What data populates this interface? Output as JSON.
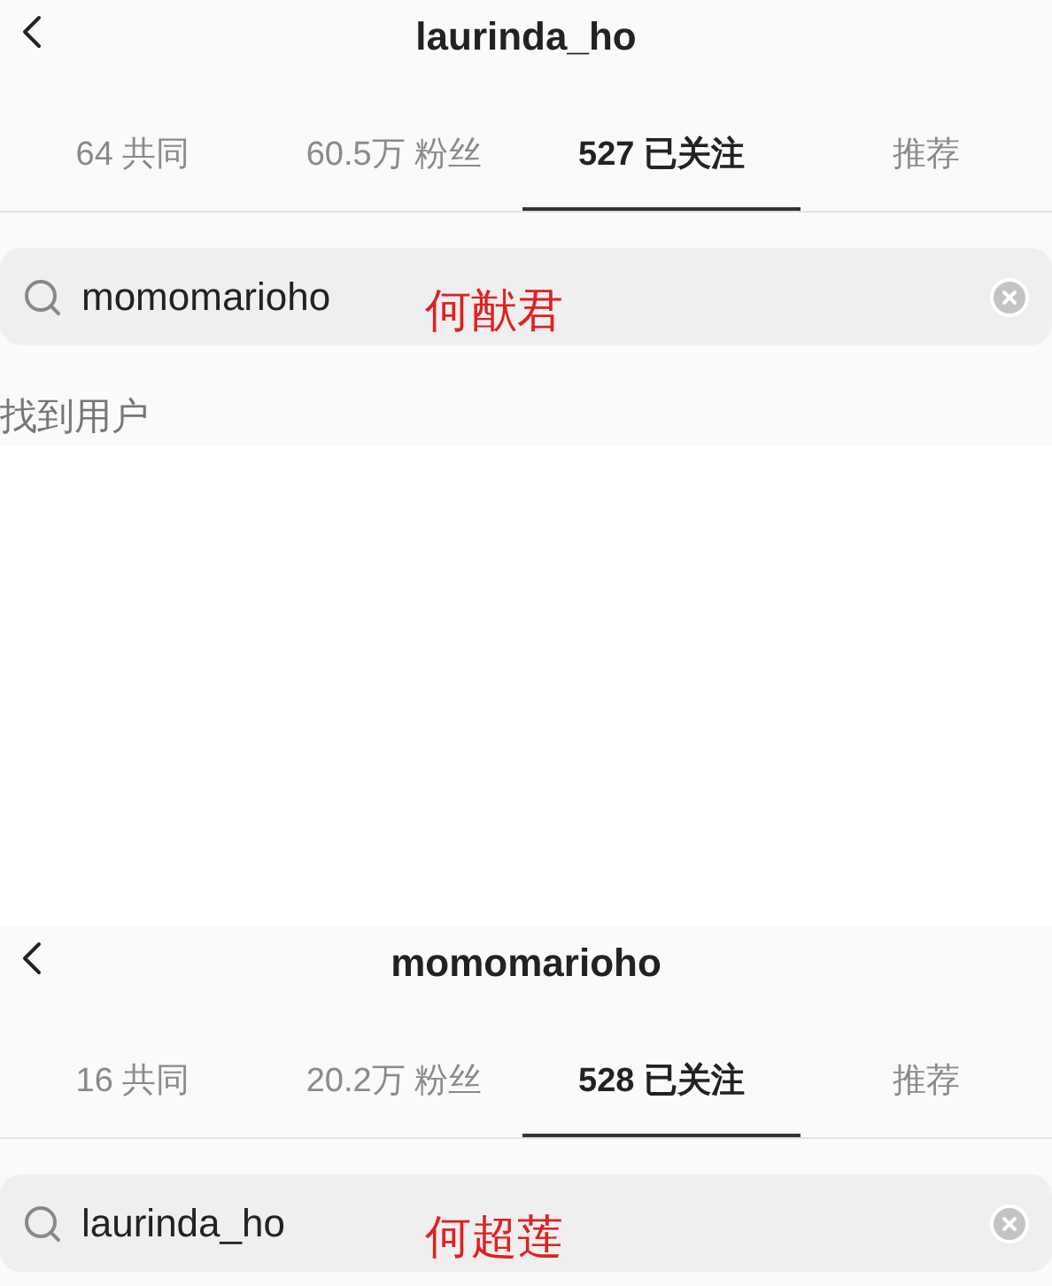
{
  "screens": [
    {
      "title": "laurinda_ho",
      "tabs": [
        {
          "label": "64 共同",
          "selected": false
        },
        {
          "label": "60.5万 粉丝",
          "selected": false
        },
        {
          "label": "527 已关注",
          "selected": true
        },
        {
          "label": "推荐",
          "selected": false
        }
      ],
      "search": {
        "value": "momomarioho"
      },
      "annotation": "何猷君",
      "result": "找到用户"
    },
    {
      "title": "momomarioho",
      "tabs": [
        {
          "label": "16 共同",
          "selected": false
        },
        {
          "label": "20.2万 粉丝",
          "selected": false
        },
        {
          "label": "528 已关注",
          "selected": true
        },
        {
          "label": "推荐",
          "selected": false
        }
      ],
      "search": {
        "value": "laurinda_ho"
      },
      "annotation": "何超莲"
    }
  ]
}
